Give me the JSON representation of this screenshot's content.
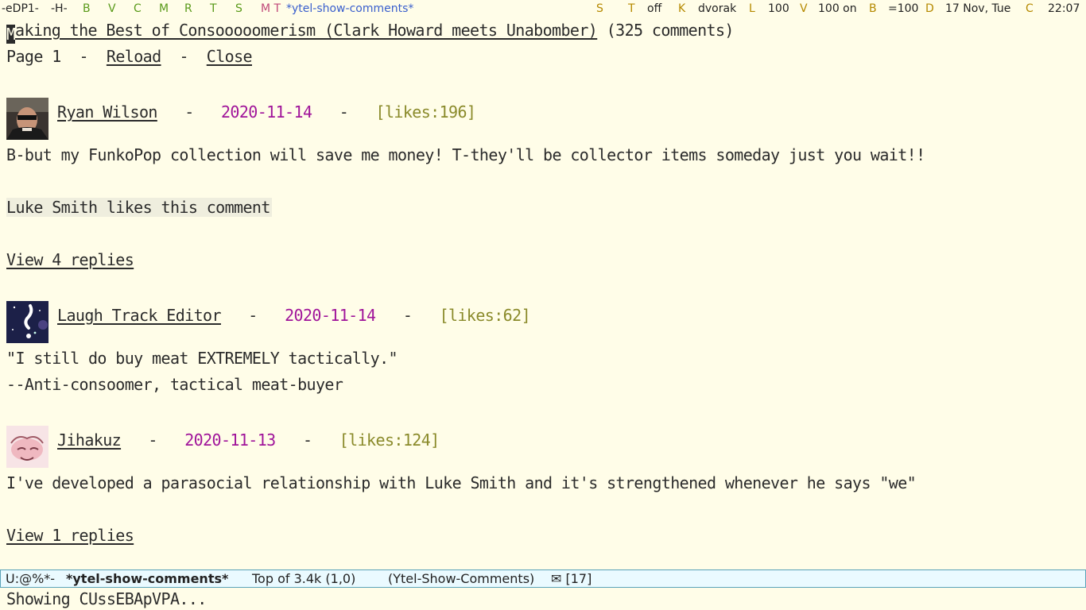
{
  "topbar": {
    "workspace": "-eDP1-",
    "h_indicator": "-H-",
    "letters": [
      "B",
      "V",
      "C",
      "M",
      "R",
      "T",
      "S"
    ],
    "mt": "M T",
    "buffer_name": "*ytel-show-comments*",
    "s_label": "S",
    "t_label": "T",
    "t_value": "off",
    "k_label": "K",
    "k_value": "dvorak",
    "l_label": "L",
    "l_value": "100",
    "v_label": "V",
    "v_value": "100 on",
    "b_label": "B",
    "b_value": "=100",
    "d_label": "D",
    "d_value": "17 Nov, Tue",
    "c_label": "C",
    "c_value": "22:07"
  },
  "header": {
    "cursor_char": "M",
    "video_title_rest": "aking the Best of Consooooomerism (Clark Howard meets Unabomber)",
    "comment_count": "(325 comments)",
    "page_label": "Page 1",
    "separator": "-",
    "reload": "Reload",
    "close": "Close"
  },
  "comments": [
    {
      "author": "Ryan Wilson",
      "date": "2020-11-14",
      "likes": "[likes:196]",
      "text": [
        "B-but my FunkoPop collection will save me money! T-they'll be collector items someday just you wait!!"
      ],
      "creator_like": "Luke Smith likes this comment",
      "replies": "View 4 replies"
    },
    {
      "author": "Laugh Track Editor",
      "date": "2020-11-14",
      "likes": "[likes:62]",
      "text": [
        "\"I still do buy meat EXTREMELY tactically.\"",
        "--Anti-consoomer, tactical meat-buyer"
      ]
    },
    {
      "author": "Jihakuz",
      "date": "2020-11-13",
      "likes": "[likes:124]",
      "text": [
        "I've developed a parasocial relationship with Luke Smith and it's strengthened whenever he says \"we\""
      ],
      "replies": "View 1 replies"
    }
  ],
  "modeline": {
    "state": "U:@%*-",
    "buffer": "*ytel-show-comments*",
    "position": "Top of 3.4k (1,0)",
    "mode": "(Ytel-Show-Comments)",
    "mail": "✉ [17]"
  },
  "echo": "Showing CUssEBApVPA...",
  "colors": {
    "background": "#fffde8",
    "date": "#a0149a",
    "likes": "#8a8a2a",
    "modeline_bg": "#eafaff",
    "modeline_border": "#5aa3b8"
  }
}
